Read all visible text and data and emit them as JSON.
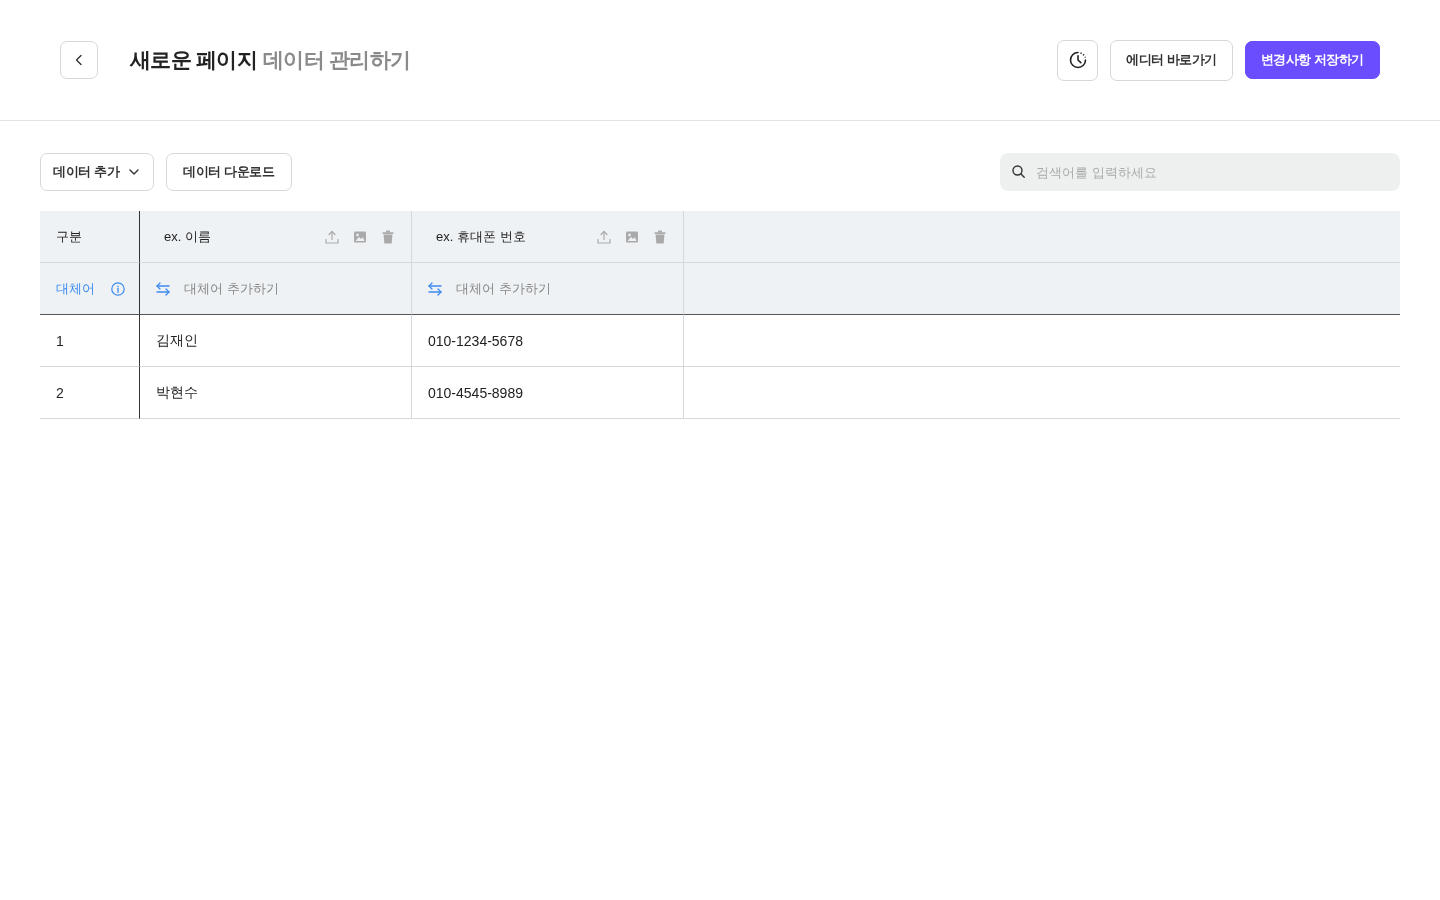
{
  "header": {
    "title": "새로운 페이지",
    "subtitle": "데이터 관리하기",
    "buttons": [
      {
        "label": "에디터 바로가기",
        "kind": "outline"
      },
      {
        "label": "변경사항 저장하기",
        "kind": "primary"
      }
    ]
  },
  "toolbar": {
    "add_button": "데이터 추가",
    "download_button": "데이터 다운로드",
    "search": {
      "placeholder": "검색어를 입력하세요"
    }
  },
  "table": {
    "corner_label": "구분",
    "synonym_label": "대체어",
    "columns": [
      {
        "label": "ex. 이름",
        "synonym_action": "대체어 추가하기"
      },
      {
        "label": "ex. 휴대폰 번호",
        "synonym_action": "대체어 추가하기"
      }
    ],
    "rows": [
      {
        "index": "1",
        "cells": [
          "김재인",
          "010-1234-5678"
        ]
      },
      {
        "index": "2",
        "cells": [
          "박현수",
          "010-4545-8989"
        ]
      }
    ]
  }
}
